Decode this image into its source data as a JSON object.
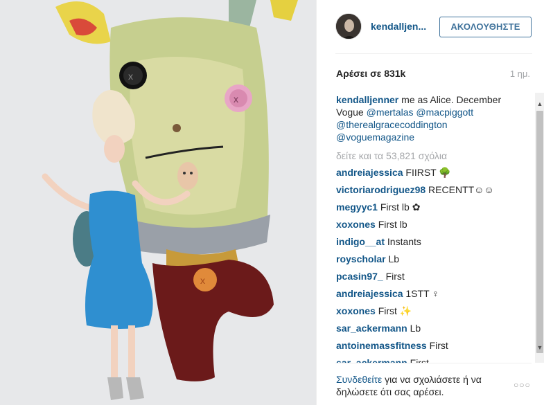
{
  "post": {
    "username": "kendalljen...",
    "follow_label": "ΑΚΟΛΟΥΘΗΣΤΕ",
    "likes": "Αρέσει σε 831k",
    "time": "1 ημ.",
    "caption": {
      "user": "kendalljenner",
      "text_1": " me as Alice. December Vogue ",
      "mention_1": "@mertalas",
      "mention_2": "@macpiggott",
      "mention_3": "@therealgracecoddington",
      "mention_4": "@voguemagazine"
    },
    "view_all": "δείτε και τα 53,821 σχόλια",
    "comments": [
      {
        "user": "andreiajessica",
        "text": "FIIRST 🌳"
      },
      {
        "user": "victoriarodriguez98",
        "text": "RECENTT☺☺"
      },
      {
        "user": "megyyc1",
        "text": "First lb ✿"
      },
      {
        "user": "xoxones",
        "text": "First lb"
      },
      {
        "user": "indigo__at",
        "text": "Instants"
      },
      {
        "user": "royscholar",
        "text": "Lb"
      },
      {
        "user": "pcasin97_",
        "text": "First"
      },
      {
        "user": "andreiajessica",
        "text": "1STT ♀"
      },
      {
        "user": "xoxones",
        "text": "First ✨"
      },
      {
        "user": "sar_ackermann",
        "text": "Lb"
      },
      {
        "user": "antoinemassfitness",
        "text": "First"
      },
      {
        "user": "sar_ackermann",
        "text": "First"
      }
    ],
    "footer": {
      "login": "Συνδεθείτε",
      "rest": " για να σχολιάσετε ή να δηλώσετε ότι σας αρέσει."
    },
    "more_label": "○○○"
  },
  "icons": {
    "scroll_up": "▲",
    "scroll_down": "▼"
  },
  "colors": {
    "link": "#125688",
    "follow_border": "#3f729b",
    "muted": "#a5a7aa"
  }
}
